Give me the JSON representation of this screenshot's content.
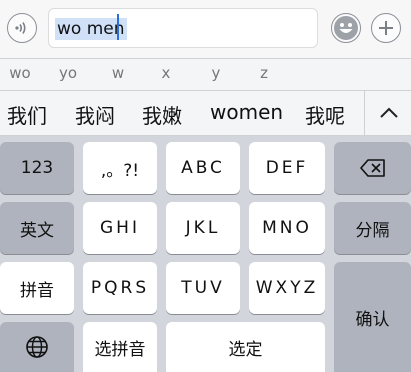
{
  "input": {
    "value": "wo men",
    "voice_icon": "sound-waves-icon",
    "emoji_icon": "smiley-icon",
    "add_icon": "plus-icon"
  },
  "pinyin_options": [
    "wo",
    "yo",
    "w",
    "x",
    "y",
    "z"
  ],
  "candidates": [
    "我们",
    "我闷",
    "我嫩",
    "women",
    "我呢"
  ],
  "candidate_toggle_icon": "chevron-up-icon",
  "keys": {
    "numbers": "123",
    "punct": ",。?!",
    "abc": "ABC",
    "def": "DEF",
    "backspace_icon": "backspace-icon",
    "english": "英文",
    "ghi": "GHI",
    "jkl": "JKL",
    "mno": "MNO",
    "separator": "分隔",
    "pinyin": "拼音",
    "pqrs": "PQRS",
    "tuv": "TUV",
    "wxyz": "WXYZ",
    "confirm": "确认",
    "globe_icon": "globe-icon",
    "select_pinyin": "选拼音",
    "select": "选定"
  },
  "colors": {
    "keyboard_bg": "#d2d5db",
    "light_key": "#ffffff",
    "dark_key": "#aeb3bd",
    "selection": "#cfe0f7",
    "caret": "#2a6fd8"
  }
}
